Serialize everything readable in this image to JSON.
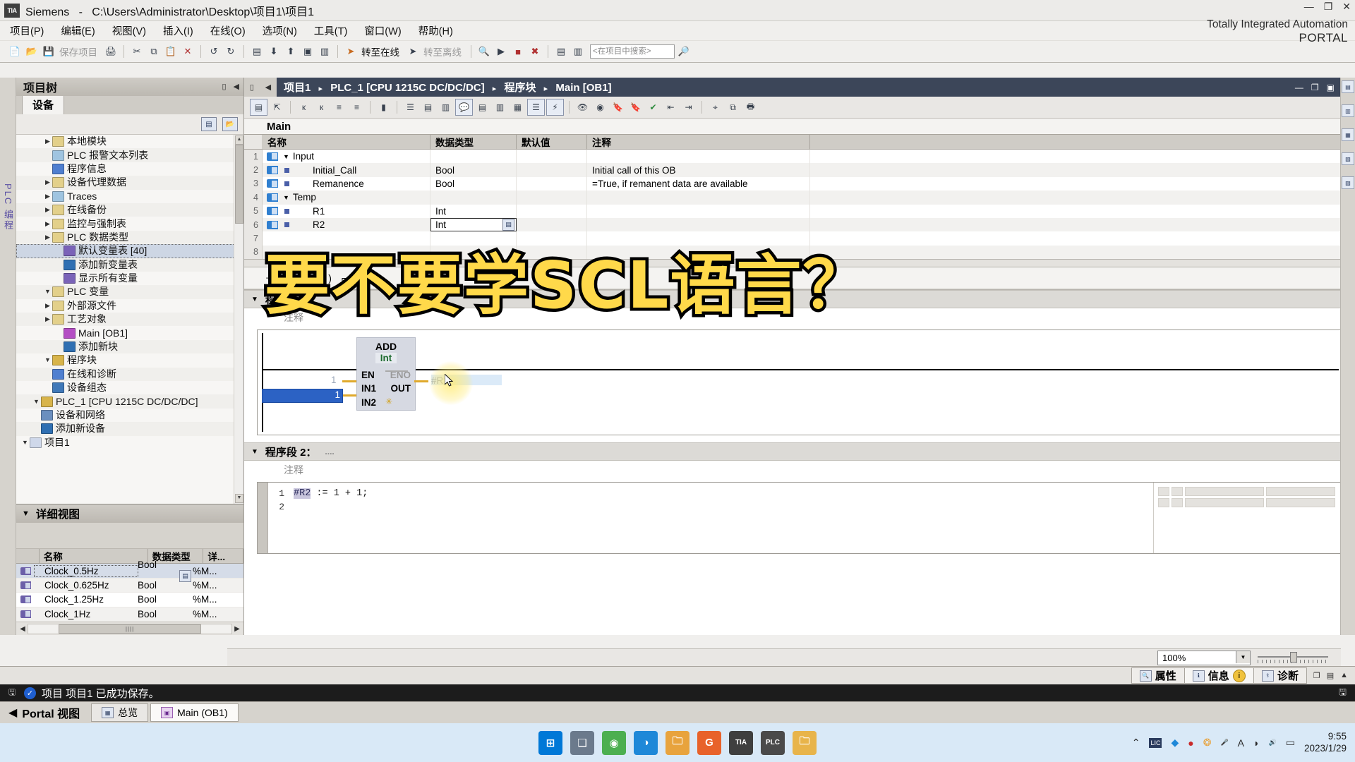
{
  "titlebar": {
    "app": "Siemens",
    "dash": "-",
    "path": "C:\\Users\\Administrator\\Desktop\\项目1\\项目1",
    "logo": "TIA",
    "minimize": "—",
    "maximize": "❐",
    "close": "✕"
  },
  "menubar": {
    "items": [
      "项目(P)",
      "编辑(E)",
      "视图(V)",
      "插入(I)",
      "在线(O)",
      "选项(N)",
      "工具(T)",
      "窗口(W)",
      "帮助(H)"
    ],
    "brand_line1": "Totally Integrated Automation",
    "brand_line2": "PORTAL"
  },
  "toolbar": {
    "save_label": "保存项目",
    "go_online": "转至在线",
    "go_offline": "转至离线",
    "search_placeholder": "<在项目中搜索>",
    "icons": [
      "new-project-icon",
      "open-project-icon",
      "save-icon",
      "print-icon",
      "cut-icon",
      "copy-icon",
      "paste-icon",
      "delete-icon",
      "undo-icon",
      "redo-icon",
      "compile-icon",
      "download-icon",
      "upload-icon",
      "start-sim-icon",
      "stop-sim-icon",
      "online-icon",
      "offline-icon",
      "diagnose-icon",
      "start-cpu-icon",
      "stop-cpu-icon",
      "close-icon",
      "split-h-icon",
      "split-v-icon",
      "search-go-icon"
    ]
  },
  "tree": {
    "title": "项目树",
    "tab": "设备",
    "toolbar_icons": [
      "list-view-icon",
      "open-folder-icon"
    ],
    "items": [
      {
        "label": "项目1",
        "indent": 0,
        "arrow": "▼",
        "color": "#cfd8ea",
        "selected": false
      },
      {
        "label": "添加新设备",
        "indent": 1,
        "arrow": "",
        "color": "#2f6fb2",
        "selected": false
      },
      {
        "label": "设备和网络",
        "indent": 1,
        "arrow": "",
        "color": "#6b8fbf",
        "selected": false
      },
      {
        "label": "PLC_1 [CPU 1215C DC/DC/DC]",
        "indent": 1,
        "arrow": "▼",
        "color": "#d8b44a",
        "selected": false
      },
      {
        "label": "设备组态",
        "indent": 2,
        "arrow": "",
        "color": "#3f78b8",
        "selected": false
      },
      {
        "label": "在线和诊断",
        "indent": 2,
        "arrow": "",
        "color": "#4f7fd0",
        "selected": false
      },
      {
        "label": "程序块",
        "indent": 2,
        "arrow": "▼",
        "color": "#d8b44a",
        "selected": false
      },
      {
        "label": "添加新块",
        "indent": 3,
        "arrow": "",
        "color": "#2f6fb2",
        "selected": false
      },
      {
        "label": "Main [OB1]",
        "indent": 3,
        "arrow": "",
        "color": "#b44ec4",
        "selected": false
      },
      {
        "label": "工艺对象",
        "indent": 2,
        "arrow": "▶",
        "color": "#e3d08a",
        "selected": false
      },
      {
        "label": "外部源文件",
        "indent": 2,
        "arrow": "▶",
        "color": "#e3d08a",
        "selected": false
      },
      {
        "label": "PLC 变量",
        "indent": 2,
        "arrow": "▼",
        "color": "#e3d08a",
        "selected": false
      },
      {
        "label": "显示所有变量",
        "indent": 3,
        "arrow": "",
        "color": "#7a63b8",
        "selected": false
      },
      {
        "label": "添加新变量表",
        "indent": 3,
        "arrow": "",
        "color": "#2f6fb2",
        "selected": false
      },
      {
        "label": "默认变量表 [40]",
        "indent": 3,
        "arrow": "",
        "color": "#7a63b8",
        "selected": true
      },
      {
        "label": "PLC 数据类型",
        "indent": 2,
        "arrow": "▶",
        "color": "#e3d08a",
        "selected": false
      },
      {
        "label": "监控与强制表",
        "indent": 2,
        "arrow": "▶",
        "color": "#e3d08a",
        "selected": false
      },
      {
        "label": "在线备份",
        "indent": 2,
        "arrow": "▶",
        "color": "#e3d08a",
        "selected": false
      },
      {
        "label": "Traces",
        "indent": 2,
        "arrow": "▶",
        "color": "#9fc4e0",
        "selected": false
      },
      {
        "label": "设备代理数据",
        "indent": 2,
        "arrow": "▶",
        "color": "#e3d08a",
        "selected": false
      },
      {
        "label": "程序信息",
        "indent": 2,
        "arrow": "",
        "color": "#4f7fd0",
        "selected": false
      },
      {
        "label": "PLC 报警文本列表",
        "indent": 2,
        "arrow": "",
        "color": "#9fc4e0",
        "selected": false
      },
      {
        "label": "本地模块",
        "indent": 2,
        "arrow": "▶",
        "color": "#e3d08a",
        "selected": false
      }
    ]
  },
  "vertical_strip": {
    "label": "PLC 编程"
  },
  "details": {
    "title": "详细视图",
    "columns": [
      "名称",
      "数据类型",
      "详..."
    ],
    "rows": [
      {
        "name": "Clock_0.5Hz",
        "type": "Bool",
        "detail": "%M...",
        "selected": true
      },
      {
        "name": "Clock_0.625Hz",
        "type": "Bool",
        "detail": "%M...",
        "selected": false
      },
      {
        "name": "Clock_1.25Hz",
        "type": "Bool",
        "detail": "%M...",
        "selected": false
      },
      {
        "name": "Clock_1Hz",
        "type": "Bool",
        "detail": "%M...",
        "selected": false
      }
    ]
  },
  "breadcrumb": {
    "parts": [
      "项目1",
      "PLC_1 [CPU 1215C DC/DC/DC]",
      "程序块",
      "Main [OB1]"
    ],
    "separator": "▸",
    "minimize": "—",
    "restore": "❐",
    "maximize": "▣",
    "close": "✕"
  },
  "interface": {
    "block_name": "Main",
    "columns": [
      "名称",
      "数据类型",
      "默认值",
      "注释"
    ],
    "rows": [
      {
        "num": "1",
        "kind": "group",
        "name": "Input",
        "type": "",
        "default": "",
        "comment": ""
      },
      {
        "num": "2",
        "kind": "var",
        "name": "Initial_Call",
        "type": "Bool",
        "default": "",
        "comment": "Initial call of this OB"
      },
      {
        "num": "3",
        "kind": "var",
        "name": "Remanence",
        "type": "Bool",
        "default": "",
        "comment": "=True, if remanent data are available"
      },
      {
        "num": "4",
        "kind": "group",
        "name": "Temp",
        "type": "",
        "default": "",
        "comment": ""
      },
      {
        "num": "5",
        "kind": "var",
        "name": "R1",
        "type": "Int",
        "default": "",
        "comment": ""
      },
      {
        "num": "6",
        "kind": "var",
        "name": "R2",
        "type": "Int",
        "default": "",
        "comment": "",
        "type_editing": true
      },
      {
        "num": "7",
        "kind": "blank",
        "name": "",
        "type": "",
        "default": "",
        "comment": ""
      },
      {
        "num": "8",
        "kind": "blank",
        "name": "",
        "type": "",
        "default": "",
        "comment": ""
      }
    ]
  },
  "network1": {
    "header": "程序段 1：",
    "comment": "注释",
    "block": {
      "name": "ADD",
      "datatype": "Int",
      "en": "EN",
      "eno": "ENO",
      "in1_label": "IN1",
      "in2_label": "IN2",
      "out_label": "OUT",
      "in1_value": "1",
      "in2_value": "1",
      "out_value": "#R1",
      "in2_marker": "✳"
    }
  },
  "network2": {
    "header": "程序段 2：",
    "header_suffix": "....",
    "comment": "注释",
    "code_lines": [
      {
        "num": "1",
        "var": "#R2",
        "rest": " := 1 + 1;"
      },
      {
        "num": "2",
        "var": "",
        "rest": ""
      }
    ]
  },
  "zoom": {
    "value": "100%",
    "dropdown": "▼"
  },
  "bottom_tabs": [
    {
      "label": "属性",
      "icon": "properties-icon",
      "active": false
    },
    {
      "label": "信息",
      "icon": "info-icon",
      "active": true,
      "badge": "i"
    },
    {
      "label": "诊断",
      "icon": "diagnostics-icon",
      "active": false
    }
  ],
  "status": {
    "check": "✓",
    "message": "项目 项目1 已成功保存。",
    "save_icon": "save-state-icon"
  },
  "portal": {
    "back_arrow": "◀",
    "label": "Portal 视图",
    "tabs": [
      {
        "label": "总览",
        "icon": "overview-icon",
        "active": false
      },
      {
        "label": "Main (OB1)",
        "icon": "main-ob1-icon",
        "active": true
      }
    ]
  },
  "taskbar": {
    "icons": [
      {
        "name": "windows-start-icon",
        "glyph": "⊞",
        "color": "#0078d7"
      },
      {
        "name": "task-view-icon",
        "glyph": "❏",
        "color": "#6b7a8c"
      },
      {
        "name": "chrome-icon",
        "glyph": "◉",
        "color": "#4caf50"
      },
      {
        "name": "edge-icon",
        "glyph": "◑",
        "color": "#1e88d8"
      },
      {
        "name": "file-explorer-icon",
        "glyph": "🗀",
        "color": "#e8a33d"
      },
      {
        "name": "sogou-icon",
        "glyph": "G",
        "color": "#e8622a"
      },
      {
        "name": "tia-portal-icon",
        "glyph": "TIA",
        "color": "#3f3f3f"
      },
      {
        "name": "plcsim-icon",
        "glyph": "PLC",
        "color": "#4a4a4a"
      },
      {
        "name": "folder-icon",
        "glyph": "🗀",
        "color": "#e8b44a"
      }
    ],
    "tray": [
      {
        "name": "show-hidden-icons",
        "glyph": "⌃"
      },
      {
        "name": "licence-manager-icon",
        "glyph": "LIC"
      },
      {
        "name": "messenger-icon",
        "glyph": "◆"
      },
      {
        "name": "recording-icon",
        "glyph": "●"
      },
      {
        "name": "sogou-pinyin-icon",
        "glyph": "❂"
      },
      {
        "name": "microphone-icon",
        "glyph": "🎤"
      },
      {
        "name": "ime-icon",
        "glyph": "A"
      },
      {
        "name": "wifi-icon",
        "glyph": "◗"
      },
      {
        "name": "volume-icon",
        "glyph": "🔊"
      },
      {
        "name": "battery-icon",
        "glyph": "▭"
      }
    ],
    "time": "9:55",
    "date": "2023/1/29"
  },
  "overlay": {
    "caption": "要不要学SCL语言？"
  },
  "colors": {
    "accent": "#3c4659",
    "caption_fill": "#ffd94a",
    "caption_stroke": "#000000",
    "selection": "#cdd6e4",
    "status_bg": "#1c1c1c"
  }
}
